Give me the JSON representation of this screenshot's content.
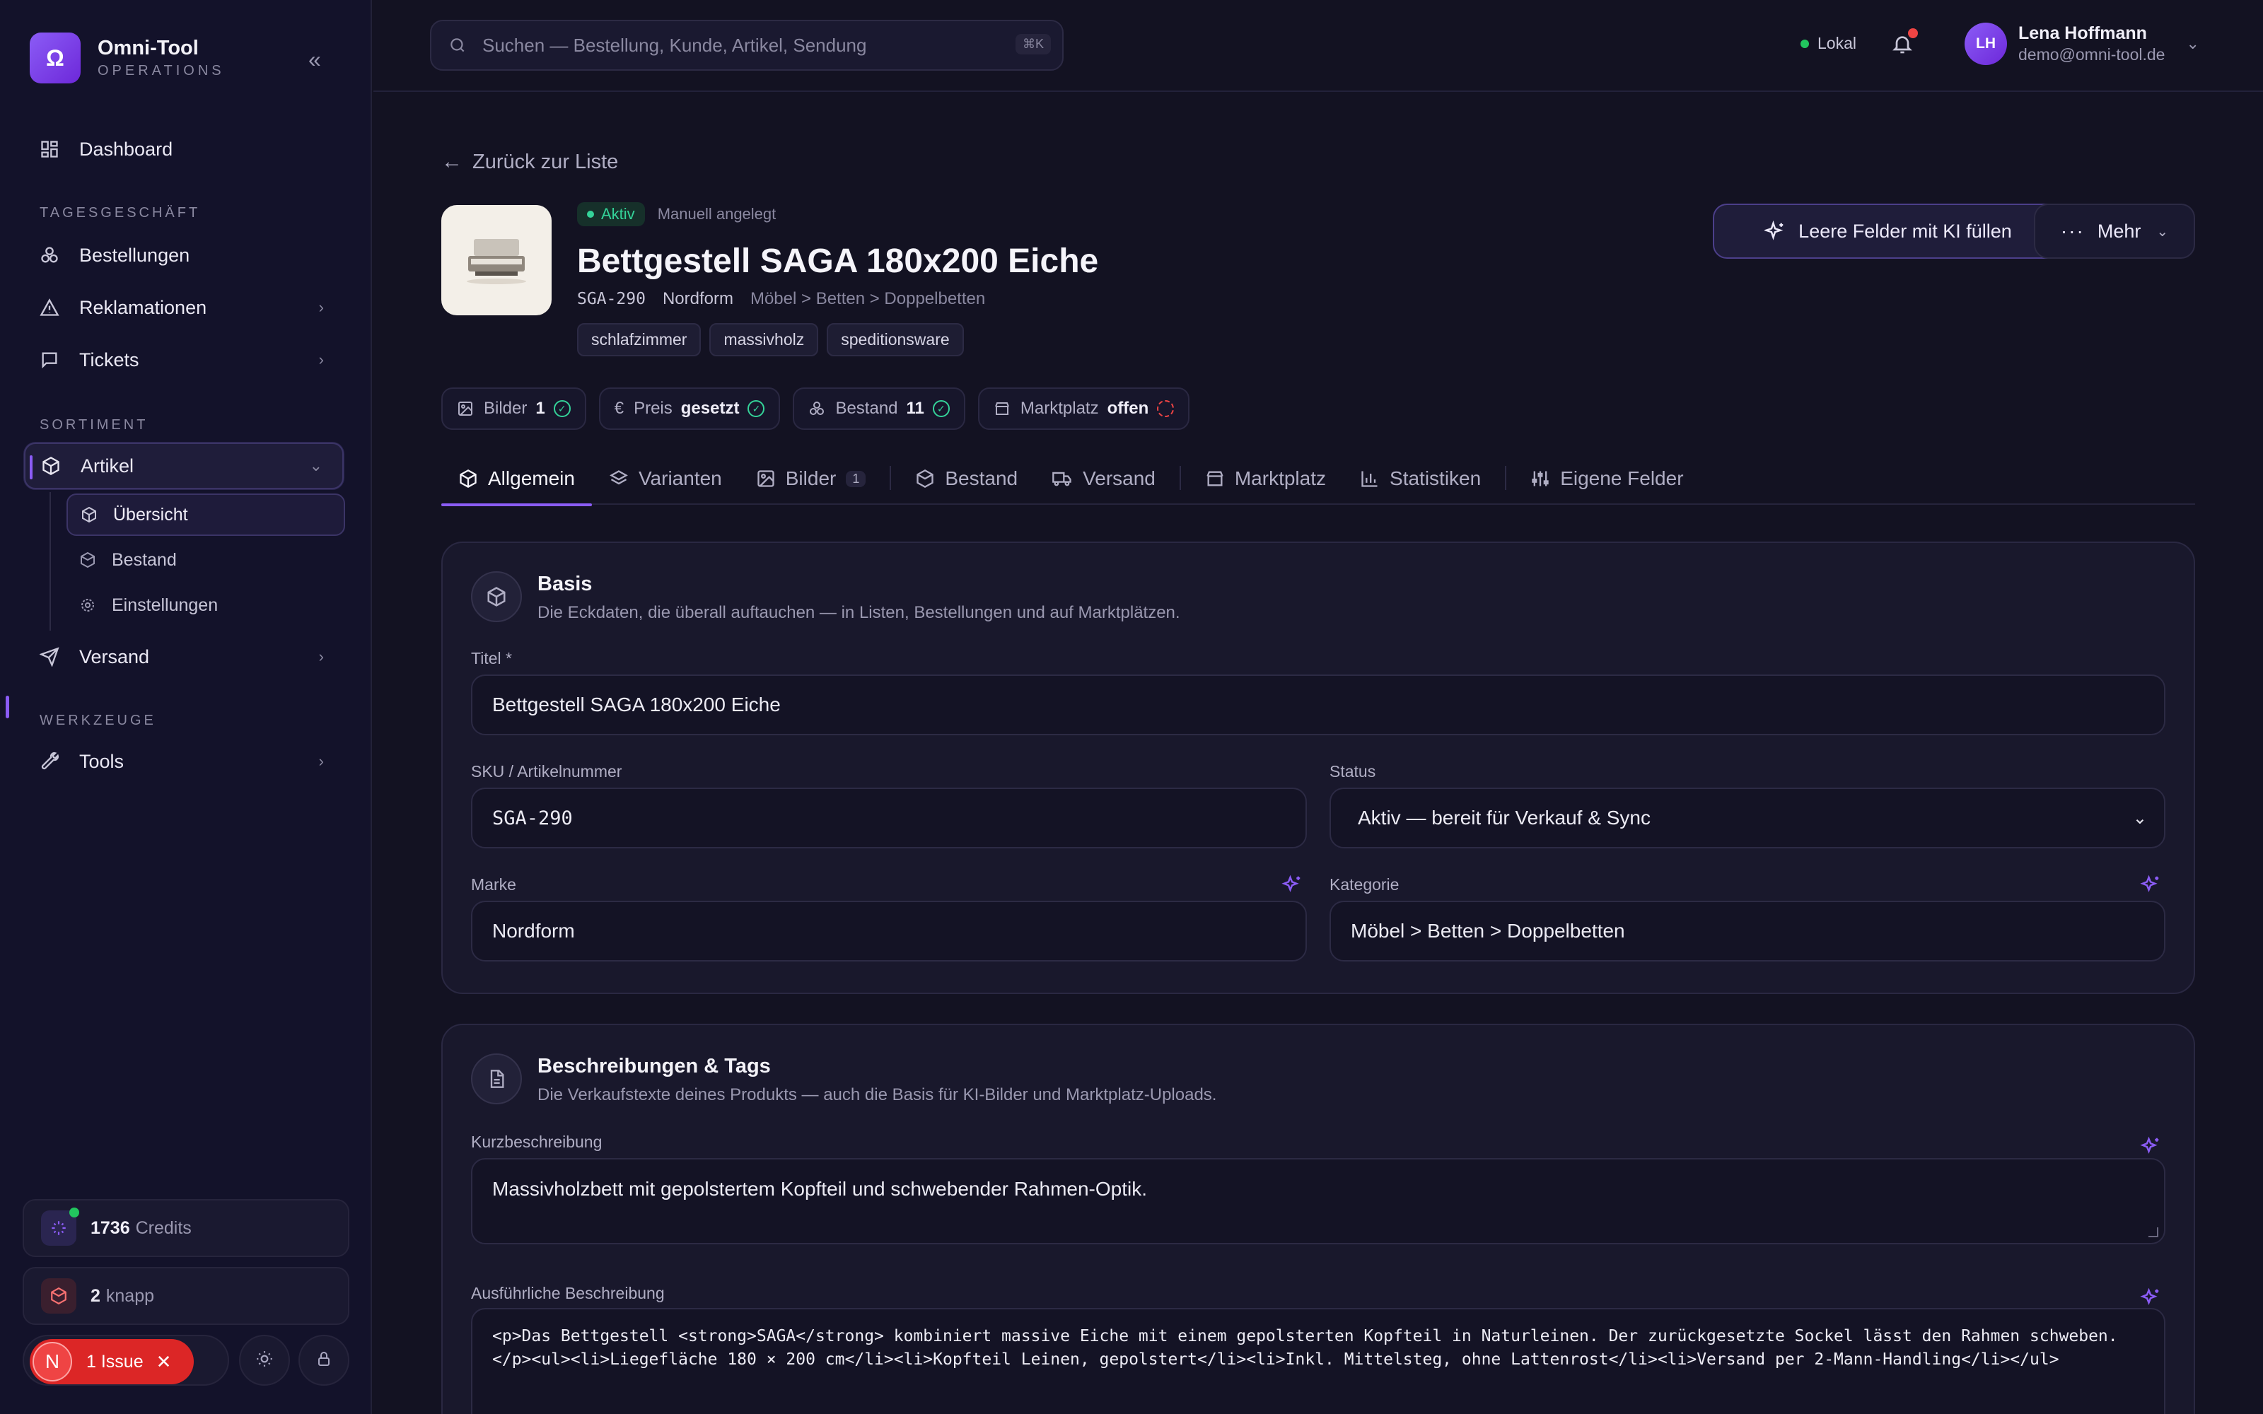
{
  "brand": {
    "name": "Omni-Tool",
    "subtitle": "OPERATIONS",
    "logo_glyph": "Ω"
  },
  "sidebar": {
    "dashboard": "Dashboard",
    "section_daily": "TAGESGESCHÄFT",
    "bestellungen": "Bestellungen",
    "reklamationen": "Reklamationen",
    "tickets": "Tickets",
    "section_sortiment": "SORTIMENT",
    "artikel": "Artikel",
    "sub": {
      "uebersicht": "Übersicht",
      "bestand": "Bestand",
      "einstellungen": "Einstellungen"
    },
    "versand": "Versand",
    "section_tools": "WERKZEUGE",
    "tools": "Tools"
  },
  "footer": {
    "credits_value": "1736",
    "credits_label": "Credits",
    "knapp_value": "2",
    "knapp_label": "knapp",
    "issue_avatar": "N",
    "issue_label": "1 Issue"
  },
  "topbar": {
    "search_placeholder": "Suchen — Bestellung, Kunde, Artikel, Sendung",
    "shortcut": "⌘K",
    "env": "Lokal",
    "user_initials": "LH",
    "user_name": "Lena Hoffmann",
    "user_email": "demo@omni-tool.de"
  },
  "product": {
    "back": "Zurück zur Liste",
    "status": "Aktiv",
    "origin": "Manuell angelegt",
    "title": "Bettgestell SAGA 180x200 Eiche",
    "sku": "SGA-290",
    "brand": "Nordform",
    "category": "Möbel > Betten > Doppelbetten",
    "tags": [
      "schlafzimmer",
      "massivholz",
      "speditionsware"
    ]
  },
  "actions": {
    "ki_fill": "Leere Felder mit KI füllen",
    "more": "Mehr"
  },
  "chips": {
    "bilder_label": "Bilder",
    "bilder_value": "1",
    "preis_label": "Preis",
    "preis_value": "gesetzt",
    "bestand_label": "Bestand",
    "bestand_value": "11",
    "markt_label": "Marktplatz",
    "markt_value": "offen"
  },
  "tabs": {
    "allgemein": "Allgemein",
    "varianten": "Varianten",
    "bilder": "Bilder",
    "bilder_count": "1",
    "bestand": "Bestand",
    "versand": "Versand",
    "marktplatz": "Marktplatz",
    "statistiken": "Statistiken",
    "eigene_felder": "Eigene Felder"
  },
  "basis": {
    "title": "Basis",
    "desc": "Die Eckdaten, die überall auftauchen — in Listen, Bestellungen und auf Marktplätzen.",
    "titel_label": "Titel *",
    "titel_value": "Bettgestell SAGA 180x200 Eiche",
    "sku_label": "SKU / Artikelnummer",
    "sku_value": "SGA-290",
    "status_label": "Status",
    "status_value": "Aktiv — bereit für Verkauf & Sync",
    "marke_label": "Marke",
    "marke_value": "Nordform",
    "kategorie_label": "Kategorie",
    "kategorie_value": "Möbel > Betten > Doppelbetten"
  },
  "desc_card": {
    "title": "Beschreibungen & Tags",
    "desc": "Die Verkaufstexte deines Produkts — auch die Basis für KI-Bilder und Marktplatz-Uploads.",
    "short_label": "Kurzbeschreibung",
    "short_value": "Massivholzbett mit gepolstertem Kopfteil und schwebender Rahmen-Optik.",
    "long_label": "Ausführliche Beschreibung",
    "long_value": "<p>Das Bettgestell <strong>SAGA</strong> kombiniert massive Eiche mit einem gepolsterten Kopfteil in Naturleinen. Der zurückgesetzte Sockel lässt den Rahmen schweben.</p><ul><li>Liegefläche 180 × 200 cm</li><li>Kopfteil Leinen, gepolstert</li><li>Inkl. Mittelsteg, ohne Lattenrost</li><li>Versand per 2-Mann-Handling</li></ul>"
  },
  "colors": {
    "accent": "#8b5cf6",
    "success": "#34d399",
    "danger": "#dc2626",
    "background": "#131222"
  }
}
